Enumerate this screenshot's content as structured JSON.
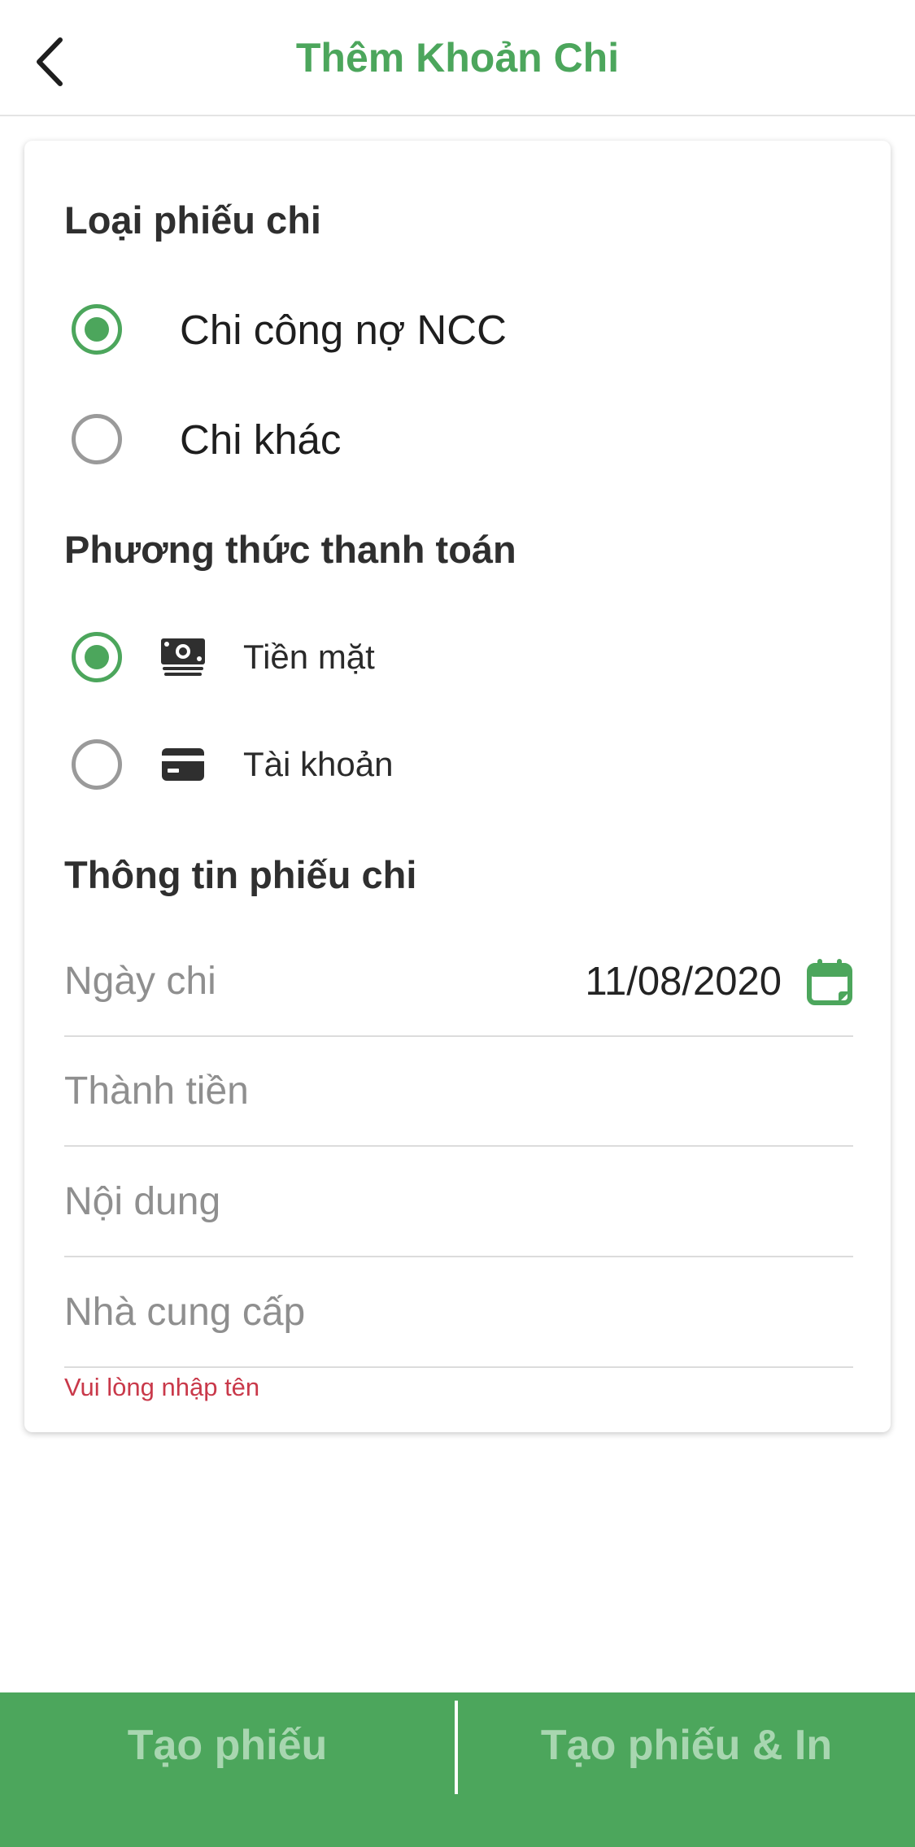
{
  "header": {
    "title": "Thêm Khoản Chi"
  },
  "voucher_type": {
    "title": "Loại phiếu chi",
    "options": [
      {
        "label": "Chi công nợ NCC",
        "selected": true
      },
      {
        "label": "Chi khác",
        "selected": false
      }
    ]
  },
  "payment_method": {
    "title": "Phương thức thanh toán",
    "options": [
      {
        "label": "Tiền mặt",
        "icon": "cash-icon",
        "selected": true
      },
      {
        "label": "Tài khoản",
        "icon": "card-icon",
        "selected": false
      }
    ]
  },
  "voucher_info": {
    "title": "Thông tin phiếu chi",
    "date": {
      "placeholder": "Ngày chi",
      "value": "11/08/2020"
    },
    "amount": {
      "placeholder": "Thành tiền"
    },
    "content": {
      "placeholder": "Nội dung"
    },
    "supplier": {
      "placeholder": "Nhà cung cấp",
      "error": "Vui lòng nhập tên"
    }
  },
  "footer": {
    "create_label": "Tạo phiếu",
    "create_print_label": "Tạo phiếu & In"
  },
  "colors": {
    "accent": "#4ca65c",
    "error": "#c9394a",
    "footer_text": "#a8d6b0"
  }
}
